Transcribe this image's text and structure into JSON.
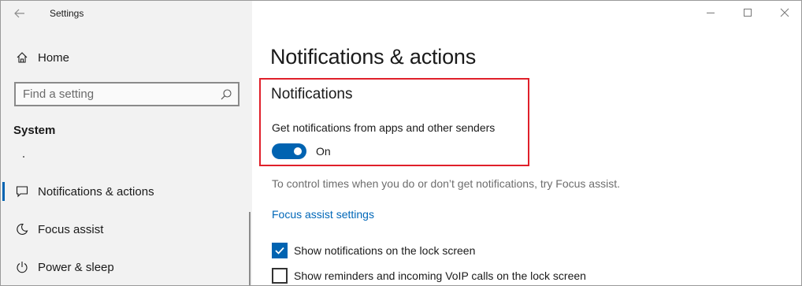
{
  "window": {
    "title": "Settings"
  },
  "sidebar": {
    "home_label": "Home",
    "search": {
      "placeholder": "Find a setting"
    },
    "section_heading": "System",
    "items": [
      {
        "label": "Notifications & actions",
        "icon": "message-icon",
        "active": true
      },
      {
        "label": "Focus assist",
        "icon": "moon-icon",
        "active": false
      },
      {
        "label": "Power & sleep",
        "icon": "power-icon",
        "active": false
      }
    ]
  },
  "main": {
    "page_title": "Notifications & actions",
    "notifications": {
      "heading": "Notifications",
      "description": "Get notifications from apps and other senders",
      "toggle_state": "On"
    },
    "focus_assist_text": "To control times when you do or don’t get notifications, try Focus assist.",
    "focus_assist_link": "Focus assist settings",
    "checkboxes": [
      {
        "label": "Show notifications on the lock screen",
        "checked": true
      },
      {
        "label": "Show reminders and incoming VoIP calls on the lock screen",
        "checked": false
      }
    ]
  },
  "colors": {
    "accent": "#0063b1",
    "link": "#0067b8",
    "highlight_border": "#e0202a",
    "sidebar_bg": "#f2f2f2"
  }
}
